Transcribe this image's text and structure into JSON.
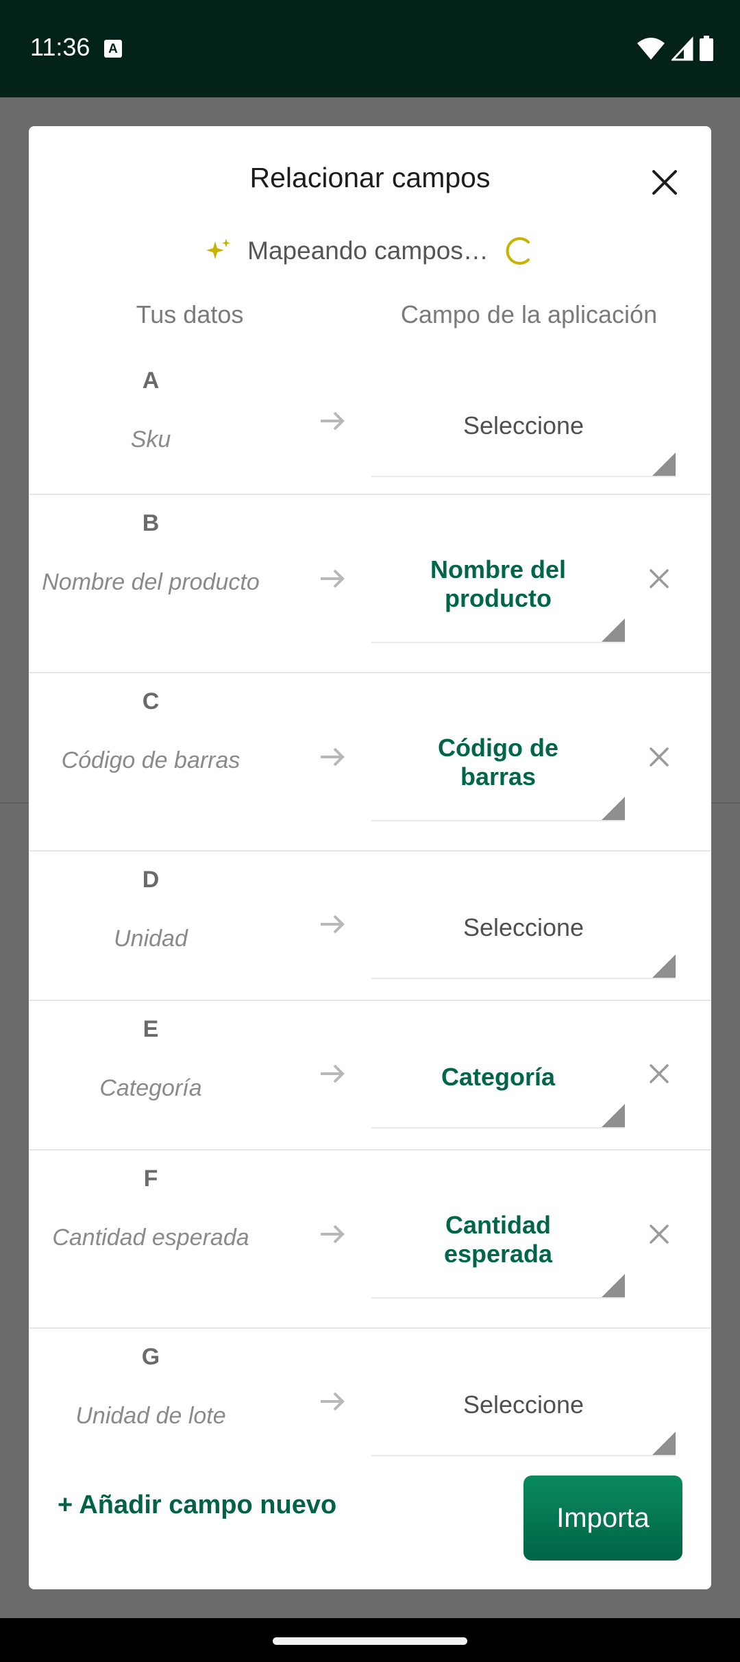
{
  "status_bar": {
    "time": "11:36",
    "notification_badge": "A"
  },
  "dialog": {
    "title": "Relacionar campos",
    "mapping_status": "Mapeando campos…",
    "col_header_left": "Tus datos",
    "col_header_right": "Campo de la aplicación",
    "rows": [
      {
        "letter": "A",
        "name": "Sku",
        "mapped": "Seleccione",
        "is_mapped": false
      },
      {
        "letter": "B",
        "name": "Nombre del producto",
        "mapped": "Nombre del producto",
        "is_mapped": true
      },
      {
        "letter": "C",
        "name": "Código de barras",
        "mapped": "Código de barras",
        "is_mapped": true
      },
      {
        "letter": "D",
        "name": "Unidad",
        "mapped": "Seleccione",
        "is_mapped": false
      },
      {
        "letter": "E",
        "name": "Categoría",
        "mapped": "Categoría",
        "is_mapped": true
      },
      {
        "letter": "F",
        "name": "Cantidad esperada",
        "mapped": "Cantidad esperada",
        "is_mapped": true
      },
      {
        "letter": "G",
        "name": "Unidad de lote",
        "mapped": "Seleccione",
        "is_mapped": false
      }
    ],
    "add_field_label": "+ Añadir campo nuevo",
    "import_label": "Importa"
  },
  "colors": {
    "accent": "#006b4c",
    "status_bar": "#03231a",
    "spinner": "#c8b400"
  },
  "icons": [
    "sparkle-icon",
    "spinner-icon",
    "close-icon",
    "arrow-right-icon",
    "dropdown-triangle-icon",
    "clear-icon"
  ]
}
